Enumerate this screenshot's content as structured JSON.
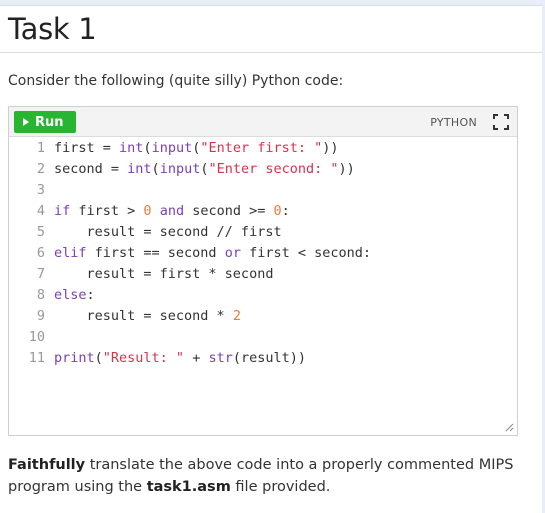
{
  "page": {
    "title": "Task 1",
    "intro": "Consider the following (quite silly) Python code:"
  },
  "editor": {
    "run_label": "Run",
    "language": "PYTHON",
    "lines": [
      {
        "n": "1",
        "code": "first = int(input(\"Enter first: \"))"
      },
      {
        "n": "2",
        "code": "second = int(input(\"Enter second: \"))"
      },
      {
        "n": "3",
        "code": ""
      },
      {
        "n": "4",
        "code": "if first > 0 and second >= 0:"
      },
      {
        "n": "5",
        "code": "    result = second // first"
      },
      {
        "n": "6",
        "code": "elif first == second or first < second:"
      },
      {
        "n": "7",
        "code": "    result = first * second"
      },
      {
        "n": "8",
        "code": "else:"
      },
      {
        "n": "9",
        "code": "    result = second * 2"
      },
      {
        "n": "10",
        "code": ""
      },
      {
        "n": "11",
        "code": "print(\"Result: \" + str(result))"
      }
    ]
  },
  "footer": {
    "bold1": "Faithfully",
    "text1": " translate the above code into a properly commented MIPS program using the ",
    "bold2": "task1.asm",
    "text2": " file provided."
  },
  "colors": {
    "run_button": "#29b532",
    "keyword": "#7b3fb8",
    "string": "#d6334d",
    "number": "#f07a37"
  }
}
